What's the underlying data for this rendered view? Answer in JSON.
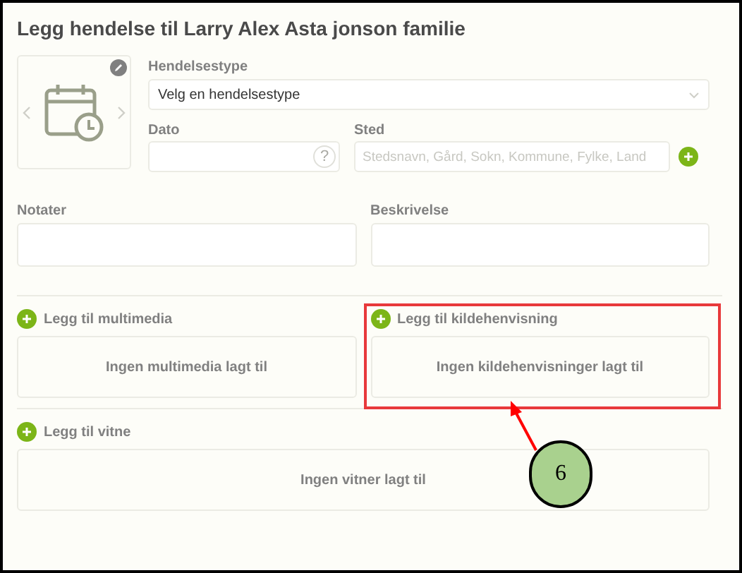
{
  "title": "Legg hendelse til Larry Alex Asta jonson familie",
  "event_type": {
    "label": "Hendelsestype",
    "value": "Velg en hendelsestype"
  },
  "date": {
    "label": "Dato",
    "help": "?"
  },
  "place": {
    "label": "Sted",
    "placeholder": "Stedsnavn, Gård, Sokn, Kommune, Fylke, Land"
  },
  "notes": {
    "label": "Notater"
  },
  "description": {
    "label": "Beskrivelse"
  },
  "sections": [
    {
      "label": "Legg til multimedia",
      "empty": "Ingen multimedia lagt til",
      "highlighted": false
    },
    {
      "label": "Legg til kildehenvisning",
      "empty": "Ingen kildehenvisninger lagt til",
      "highlighted": true
    }
  ],
  "witnesses": {
    "label": "Legg til vitne",
    "empty": "Ingen vitner lagt til"
  },
  "callout": "6"
}
